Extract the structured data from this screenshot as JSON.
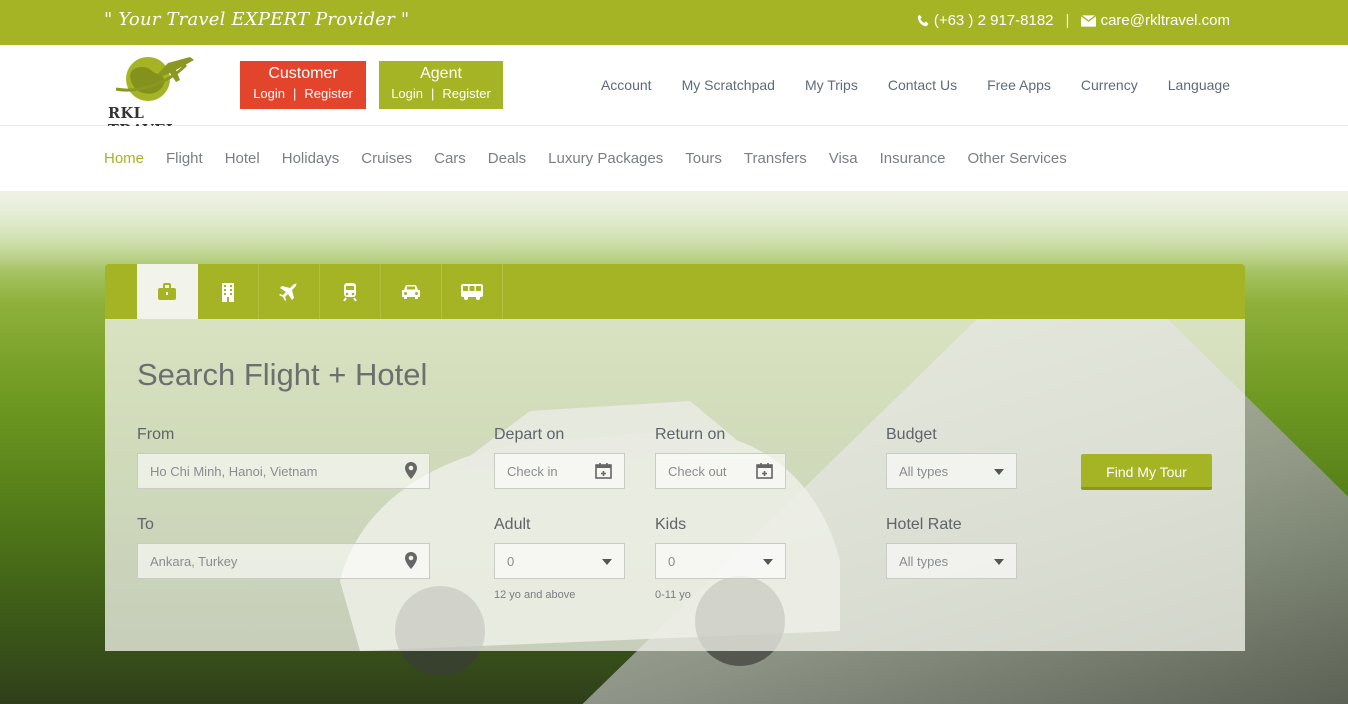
{
  "topbar": {
    "tagline": "\" Your Travel EXPERT Provider \"",
    "phone": "(+63 ) 2 917-8182",
    "email": "care@rkltravel.com",
    "separator": "|"
  },
  "logo": {
    "text": "RKL TRAVEL"
  },
  "customer_box": {
    "title": "Customer",
    "login": "Login",
    "register": "Register",
    "sep": "|"
  },
  "agent_box": {
    "title": "Agent",
    "login": "Login",
    "register": "Register",
    "sep": "|"
  },
  "top_nav": [
    "Account",
    "My Scratchpad",
    "My Trips",
    "Contact Us",
    "Free Apps",
    "Currency",
    "Language"
  ],
  "main_nav": [
    "Home",
    "Flight",
    "Hotel",
    "Holidays",
    "Cruises",
    "Cars",
    "Deals",
    "Luxury Packages",
    "Tours",
    "Transfers",
    "Visa",
    "Insurance",
    "Other Services"
  ],
  "search_tabs": [
    "briefcase-icon",
    "building-icon",
    "plane-icon",
    "train-icon",
    "car-icon",
    "bus-icon"
  ],
  "search": {
    "title": "Search Flight + Hotel",
    "from_label": "From",
    "from_value": "Ho Chi Minh, Hanoi, Vietnam",
    "to_label": "To",
    "to_value": "Ankara, Turkey",
    "depart_label": "Depart on",
    "depart_placeholder": "Check in",
    "return_label": "Return on",
    "return_placeholder": "Check out",
    "budget_label": "Budget",
    "budget_value": "All types",
    "adult_label": "Adult",
    "adult_value": "0",
    "adult_hint": "12 yo and above",
    "kids_label": "Kids",
    "kids_value": "0",
    "kids_hint": "0-11 yo",
    "hotel_rate_label": "Hotel Rate",
    "hotel_rate_value": "All types",
    "find_button": "Find My Tour"
  },
  "colors": {
    "brand_green": "#a5b425",
    "customer_red": "#e2452c"
  }
}
